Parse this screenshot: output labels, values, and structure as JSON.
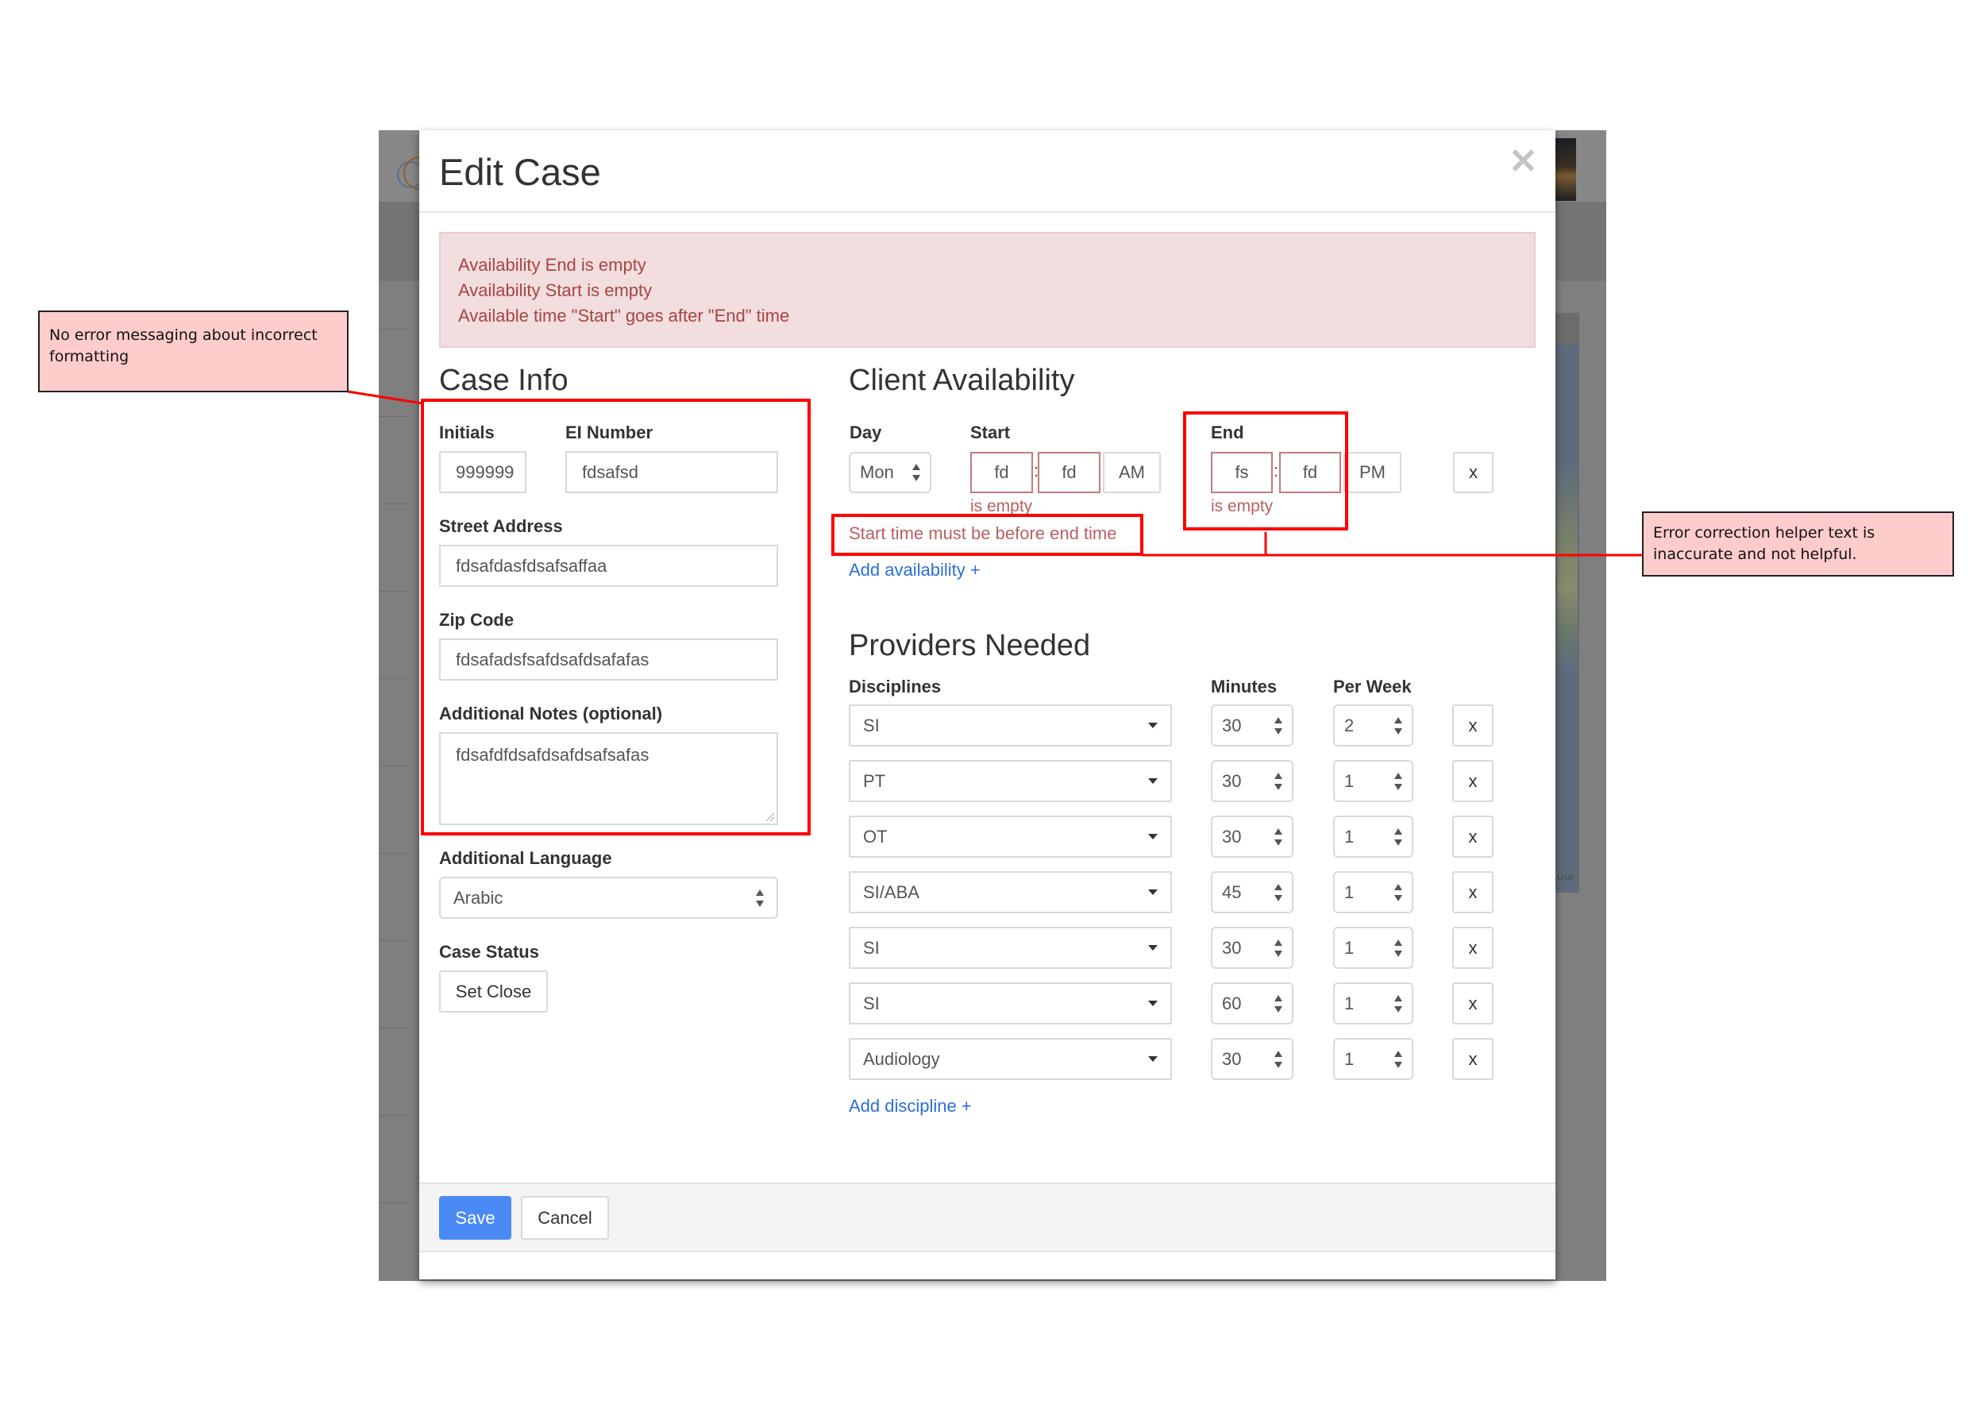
{
  "modal": {
    "title": "Edit Case",
    "close_icon": "close-icon",
    "alert_messages": [
      "Availability End is empty",
      "Availability Start is empty",
      "Available time \"Start\" goes after \"End\" time"
    ]
  },
  "case_info": {
    "heading": "Case Info",
    "initials_label": "Initials",
    "initials_value": "999999",
    "ei_number_label": "EI Number",
    "ei_number_value": "fdsafsd",
    "street_address_label": "Street Address",
    "street_address_value": "fdsafdasfdsafsaffaa",
    "zip_code_label": "Zip Code",
    "zip_code_value": "fdsafadsfsafdsafdsafafas",
    "notes_label": "Additional Notes (optional)",
    "notes_value": "fdsafdfdsafdsafdsafsafas",
    "language_label": "Additional Language",
    "language_value": "Arabic",
    "case_status_label": "Case Status",
    "set_close_label": "Set Close"
  },
  "client_availability": {
    "heading": "Client Availability",
    "day_label": "Day",
    "start_label": "Start",
    "end_label": "End",
    "day_value": "Mon",
    "start_hour": "fd",
    "start_minute": "fd",
    "start_meridiem": "AM",
    "end_hour": "fs",
    "end_minute": "fd",
    "end_meridiem": "PM",
    "separator": ":",
    "start_error": "is empty",
    "end_error": "is empty",
    "order_error": "Start time must be before end time",
    "remove_label": "x",
    "add_link": "Add availability +"
  },
  "providers": {
    "heading": "Providers Needed",
    "disciplines_label": "Disciplines",
    "minutes_label": "Minutes",
    "per_week_label": "Per Week",
    "remove_label": "x",
    "rows": [
      {
        "discipline": "SI",
        "minutes": "30",
        "per_week": "2"
      },
      {
        "discipline": "PT",
        "minutes": "30",
        "per_week": "1"
      },
      {
        "discipline": "OT",
        "minutes": "30",
        "per_week": "1"
      },
      {
        "discipline": "SI/ABA",
        "minutes": "45",
        "per_week": "1"
      },
      {
        "discipline": "SI",
        "minutes": "30",
        "per_week": "1"
      },
      {
        "discipline": "SI",
        "minutes": "60",
        "per_week": "1"
      },
      {
        "discipline": "Audiology",
        "minutes": "30",
        "per_week": "1"
      }
    ],
    "add_link": "Add discipline +"
  },
  "footer": {
    "save_label": "Save",
    "cancel_label": "Cancel"
  },
  "annotations": {
    "left_callout": "No error messaging about incorrect formatting",
    "right_callout": "Error correction helper text is inaccurate and not helpful."
  },
  "background": {
    "map_attribution": "Use"
  },
  "colors": {
    "primary": "#4a8af4",
    "error_text": "#a94442",
    "alert_bg": "#f2dede",
    "link": "#2a6fd6",
    "annotation_red": "#ff0000",
    "callout_bg": "#ffcccc"
  }
}
